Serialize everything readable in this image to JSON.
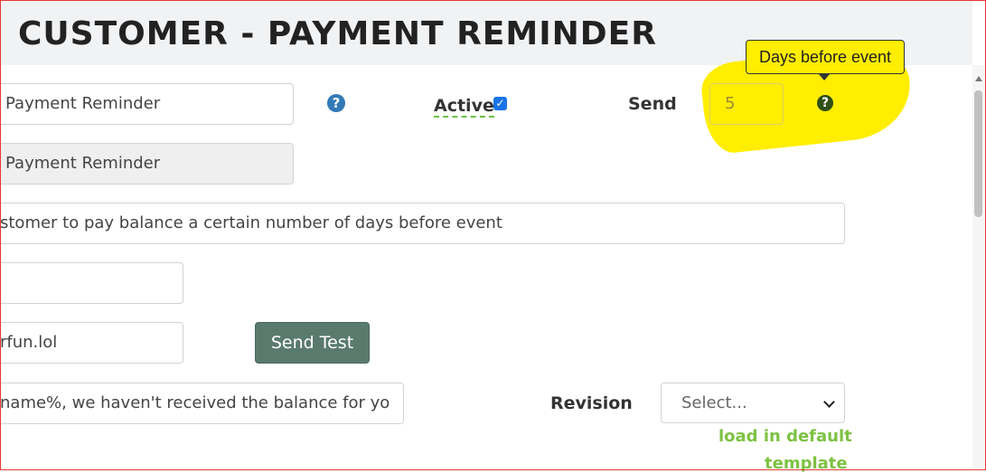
{
  "header": {
    "title": "CUSTOMER - PAYMENT REMINDER"
  },
  "form": {
    "name_value": "Payment Reminder",
    "display_name_value": "Payment Reminder",
    "description_value": "stomer to pay balance a certain number of days before event",
    "field4_value": "",
    "email_value": "rfun.lol",
    "message_value": "name%, we haven't received the balance for yo",
    "active_label": "Active",
    "active_checked": true,
    "send_label": "Send",
    "send_days_value": "5",
    "help_glyph": "?",
    "send_test_label": "Send Test",
    "revision_label": "Revision",
    "revision_select_value": "Select...",
    "load_default_line1": "load in default",
    "load_default_line2": "template"
  },
  "tooltip": {
    "text": "Days before event"
  },
  "colors": {
    "highlight": "#ffee00",
    "accent_green": "#7dc242",
    "button_bg": "#5a7a6e",
    "help_blue": "#337ab7",
    "help_dark": "#2f4f16"
  },
  "icons": [
    "question-circle-icon",
    "checkbox-checked-icon",
    "chevron-down-icon"
  ]
}
